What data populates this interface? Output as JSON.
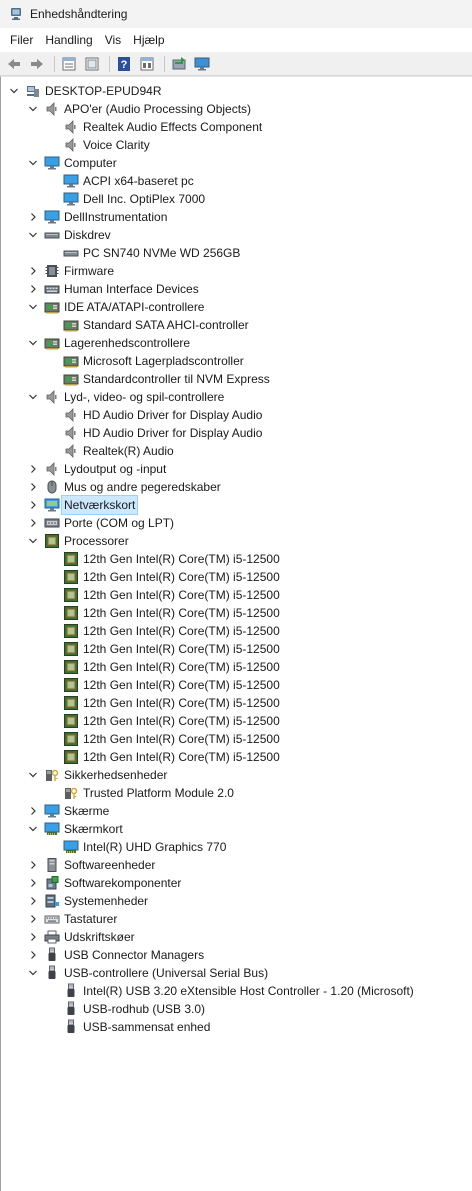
{
  "window": {
    "title": "Enhedshåndtering"
  },
  "menu": [
    "Filer",
    "Handling",
    "Vis",
    "Hjælp"
  ],
  "toolbar": [
    "back-icon",
    "forward-icon",
    "properties-icon",
    "view-icon",
    "help-icon",
    "action-icon",
    "scan-hardware-icon",
    "monitor-icon"
  ],
  "tree": [
    {
      "label": "DESKTOP-EPUD94R",
      "level": 0,
      "expanded": true,
      "icon": "computer-root-icon"
    },
    {
      "label": "APO'er (Audio Processing Objects)",
      "level": 1,
      "expanded": true,
      "icon": "speaker-icon"
    },
    {
      "label": "Realtek Audio Effects Component",
      "level": 2,
      "icon": "speaker-icon"
    },
    {
      "label": "Voice Clarity",
      "level": 2,
      "icon": "speaker-icon"
    },
    {
      "label": "Computer",
      "level": 1,
      "expanded": true,
      "icon": "monitor-icon"
    },
    {
      "label": "ACPI x64-baseret pc",
      "level": 2,
      "icon": "monitor-icon"
    },
    {
      "label": "Dell Inc. OptiPlex 7000",
      "level": 2,
      "icon": "monitor-icon"
    },
    {
      "label": "DellInstrumentation",
      "level": 1,
      "expanded": false,
      "icon": "monitor-icon"
    },
    {
      "label": "Diskdrev",
      "level": 1,
      "expanded": true,
      "icon": "disk-icon"
    },
    {
      "label": "PC SN740 NVMe WD 256GB",
      "level": 2,
      "icon": "disk-icon"
    },
    {
      "label": "Firmware",
      "level": 1,
      "expanded": false,
      "icon": "firmware-icon"
    },
    {
      "label": "Human Interface Devices",
      "level": 1,
      "expanded": false,
      "icon": "hid-icon"
    },
    {
      "label": "IDE ATA/ATAPI-controllere",
      "level": 1,
      "expanded": true,
      "icon": "controller-icon"
    },
    {
      "label": "Standard SATA AHCI-controller",
      "level": 2,
      "icon": "controller-icon"
    },
    {
      "label": "Lagerenhedscontrollere",
      "level": 1,
      "expanded": true,
      "icon": "controller-icon"
    },
    {
      "label": "Microsoft Lagerpladscontroller",
      "level": 2,
      "icon": "controller-icon"
    },
    {
      "label": "Standardcontroller til NVM Express",
      "level": 2,
      "icon": "controller-icon"
    },
    {
      "label": "Lyd-, video- og spil-controllere",
      "level": 1,
      "expanded": true,
      "icon": "speaker-icon"
    },
    {
      "label": "HD Audio Driver for Display Audio",
      "level": 2,
      "icon": "speaker-icon"
    },
    {
      "label": "HD Audio Driver for Display Audio",
      "level": 2,
      "icon": "speaker-icon"
    },
    {
      "label": "Realtek(R) Audio",
      "level": 2,
      "icon": "speaker-icon"
    },
    {
      "label": "Lydoutput og -input",
      "level": 1,
      "expanded": false,
      "icon": "speaker-icon"
    },
    {
      "label": "Mus og andre pegeredskaber",
      "level": 1,
      "expanded": false,
      "icon": "mouse-icon"
    },
    {
      "label": "Netværkskort",
      "level": 1,
      "expanded": false,
      "icon": "network-icon",
      "selected": true
    },
    {
      "label": "Porte (COM og LPT)",
      "level": 1,
      "expanded": false,
      "icon": "port-icon"
    },
    {
      "label": "Processorer",
      "level": 1,
      "expanded": true,
      "icon": "cpu-icon"
    },
    {
      "label": "12th Gen Intel(R) Core(TM) i5-12500",
      "level": 2,
      "icon": "cpu-icon"
    },
    {
      "label": "12th Gen Intel(R) Core(TM) i5-12500",
      "level": 2,
      "icon": "cpu-icon"
    },
    {
      "label": "12th Gen Intel(R) Core(TM) i5-12500",
      "level": 2,
      "icon": "cpu-icon"
    },
    {
      "label": "12th Gen Intel(R) Core(TM) i5-12500",
      "level": 2,
      "icon": "cpu-icon"
    },
    {
      "label": "12th Gen Intel(R) Core(TM) i5-12500",
      "level": 2,
      "icon": "cpu-icon"
    },
    {
      "label": "12th Gen Intel(R) Core(TM) i5-12500",
      "level": 2,
      "icon": "cpu-icon"
    },
    {
      "label": "12th Gen Intel(R) Core(TM) i5-12500",
      "level": 2,
      "icon": "cpu-icon"
    },
    {
      "label": "12th Gen Intel(R) Core(TM) i5-12500",
      "level": 2,
      "icon": "cpu-icon"
    },
    {
      "label": "12th Gen Intel(R) Core(TM) i5-12500",
      "level": 2,
      "icon": "cpu-icon"
    },
    {
      "label": "12th Gen Intel(R) Core(TM) i5-12500",
      "level": 2,
      "icon": "cpu-icon"
    },
    {
      "label": "12th Gen Intel(R) Core(TM) i5-12500",
      "level": 2,
      "icon": "cpu-icon"
    },
    {
      "label": "12th Gen Intel(R) Core(TM) i5-12500",
      "level": 2,
      "icon": "cpu-icon"
    },
    {
      "label": "Sikkerhedsenheder",
      "level": 1,
      "expanded": true,
      "icon": "security-icon"
    },
    {
      "label": "Trusted Platform Module 2.0",
      "level": 2,
      "icon": "security-icon"
    },
    {
      "label": "Skærme",
      "level": 1,
      "expanded": false,
      "icon": "monitor-icon"
    },
    {
      "label": "Skærmkort",
      "level": 1,
      "expanded": true,
      "icon": "display-adapter-icon"
    },
    {
      "label": "Intel(R) UHD Graphics 770",
      "level": 2,
      "icon": "display-adapter-icon"
    },
    {
      "label": "Softwareenheder",
      "level": 1,
      "expanded": false,
      "icon": "software-device-icon"
    },
    {
      "label": "Softwarekomponenter",
      "level": 1,
      "expanded": false,
      "icon": "software-component-icon"
    },
    {
      "label": "Systemenheder",
      "level": 1,
      "expanded": false,
      "icon": "system-folder-icon"
    },
    {
      "label": "Tastaturer",
      "level": 1,
      "expanded": false,
      "icon": "keyboard-icon"
    },
    {
      "label": "Udskriftskøer",
      "level": 1,
      "expanded": false,
      "icon": "printer-icon"
    },
    {
      "label": "USB Connector Managers",
      "level": 1,
      "expanded": false,
      "icon": "usb-icon"
    },
    {
      "label": "USB-controllere (Universal Serial Bus)",
      "level": 1,
      "expanded": true,
      "icon": "usb-icon"
    },
    {
      "label": "Intel(R) USB 3.20 eXtensible Host Controller - 1.20 (Microsoft)",
      "level": 2,
      "icon": "usb-icon"
    },
    {
      "label": "USB-rodhub (USB 3.0)",
      "level": 2,
      "icon": "usb-icon"
    },
    {
      "label": "USB-sammensat enhed",
      "level": 2,
      "icon": "usb-icon"
    }
  ]
}
